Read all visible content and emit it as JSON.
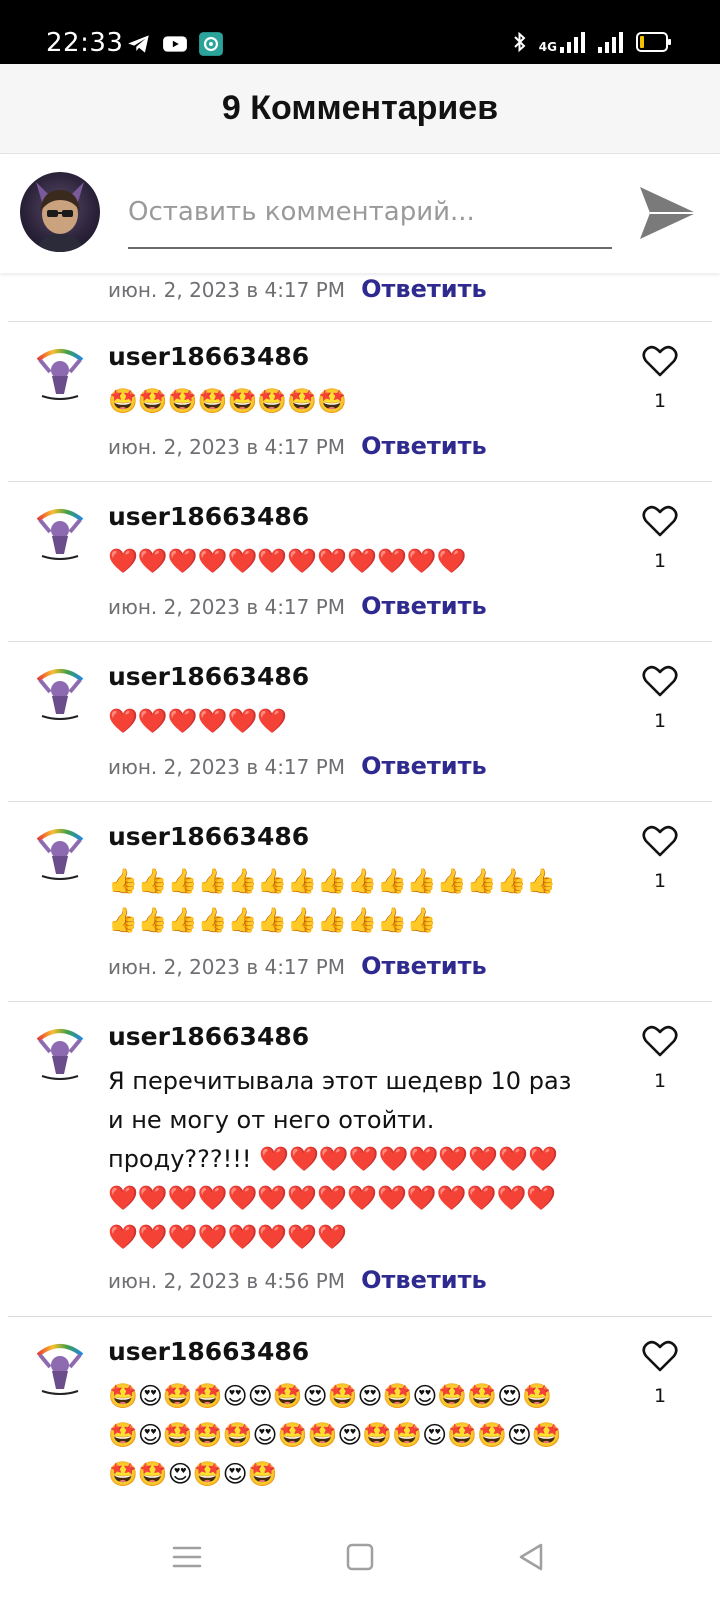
{
  "status_bar": {
    "time": "22:33",
    "apps": [
      "telegram-icon",
      "youtube-icon",
      "teal-app-icon"
    ],
    "network_label": "4G",
    "icons": [
      "bluetooth-icon",
      "signal-4g-icon",
      "signal-bars-icon",
      "battery-icon"
    ]
  },
  "header": {
    "title": "9 Комментариев"
  },
  "compose": {
    "placeholder": "Оставить комментарий...",
    "send_icon": "send-icon"
  },
  "partial_comment": {
    "date": "июн. 2, 2023 в 4:17 PM",
    "reply": "Ответить"
  },
  "comments": [
    {
      "user": "user18663486",
      "text": "🤩🤩🤩🤩🤩🤩🤩🤩",
      "date": "июн. 2, 2023 в 4:17 PM",
      "reply": "Ответить",
      "likes": "1"
    },
    {
      "user": "user18663486",
      "text": "❤️❤️❤️❤️❤️❤️❤️❤️❤️❤️❤️❤️",
      "date": "июн. 2, 2023 в 4:17 PM",
      "reply": "Ответить",
      "likes": "1"
    },
    {
      "user": "user18663486",
      "text": "❤️❤️❤️❤️❤️❤️",
      "date": "июн. 2, 2023 в 4:17 PM",
      "reply": "Ответить",
      "likes": "1"
    },
    {
      "user": "user18663486",
      "text": "👍👍👍👍👍👍👍👍👍👍👍👍👍👍👍👍👍👍👍👍👍👍👍👍👍👍",
      "date": "июн. 2, 2023 в 4:17 PM",
      "reply": "Ответить",
      "likes": "1"
    },
    {
      "user": "user18663486",
      "text": "Я перечитывала этот шедевр 10 раз и не могу от него отойти. проду???!!! ❤️❤️❤️❤️❤️❤️❤️❤️❤️❤️❤️❤️❤️❤️❤️❤️❤️❤️❤️❤️❤️❤️❤️❤️❤️❤️❤️❤️❤️❤️❤️❤️❤️",
      "date": "июн. 2, 2023 в 4:56 PM",
      "reply": "Ответить",
      "likes": "1"
    },
    {
      "user": "user18663486",
      "text": "🤩😍🤩🤩😍😍🤩😍🤩😍🤩😍🤩🤩😍🤩🤩😍🤩🤩🤩😍🤩🤩😍🤩🤩😍🤩🤩😍🤩🤩🤩😍🤩😍🤩",
      "date": "",
      "reply": "",
      "likes": "1"
    }
  ],
  "nav_bar": {
    "buttons": [
      "menu-icon",
      "home-square-icon",
      "back-triangle-icon"
    ]
  },
  "colors": {
    "reply_link": "#2f2a8f",
    "status_bar_bg": "#000000",
    "header_bg": "#f6f6f6",
    "date_text": "#6f6f73"
  }
}
